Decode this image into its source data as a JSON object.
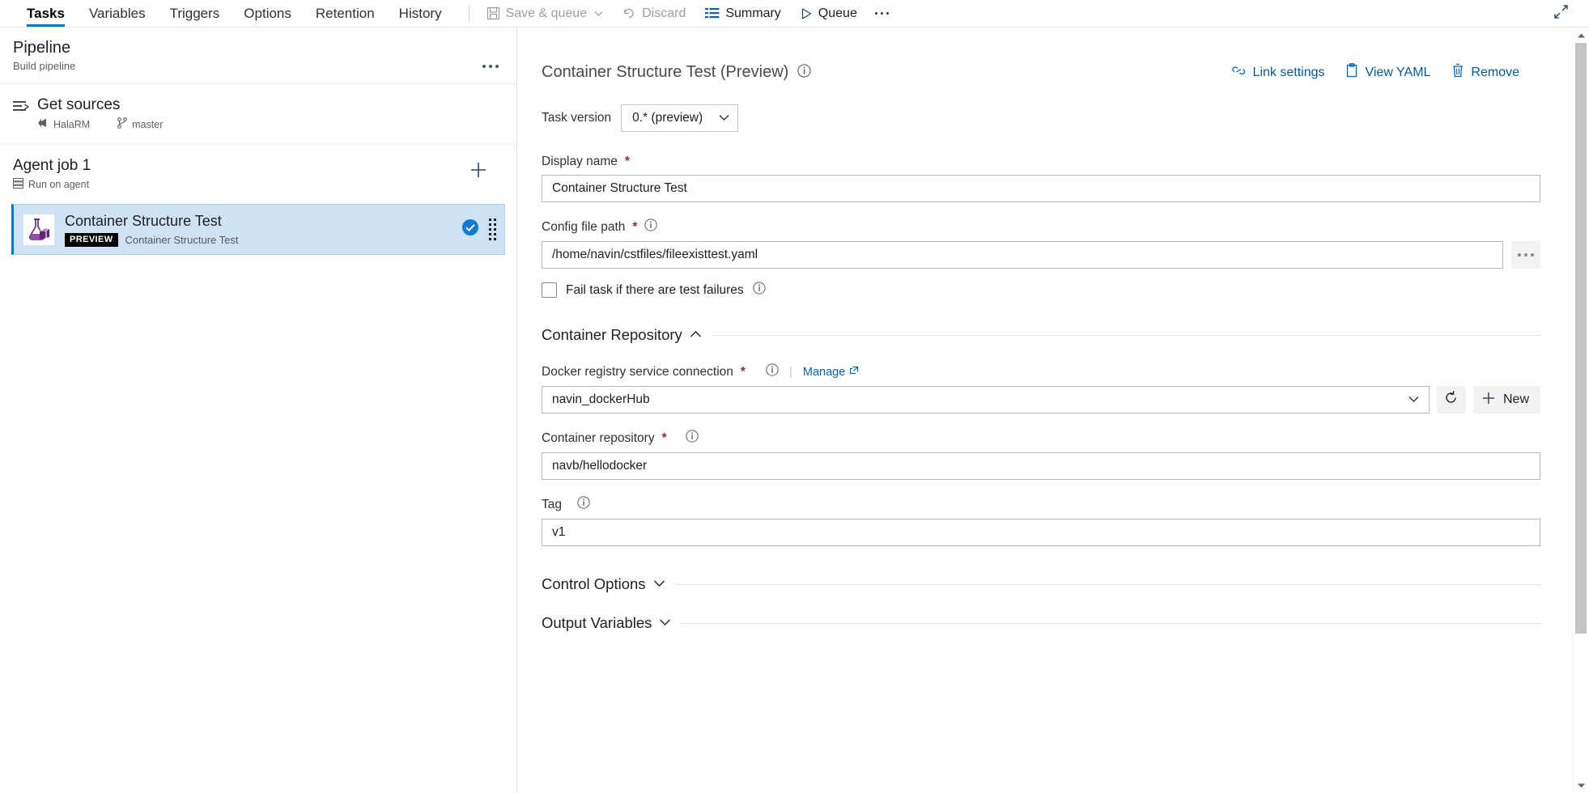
{
  "topbar": {
    "tabs": [
      {
        "label": "Tasks",
        "active": true
      },
      {
        "label": "Variables",
        "active": false
      },
      {
        "label": "Triggers",
        "active": false
      },
      {
        "label": "Options",
        "active": false
      },
      {
        "label": "Retention",
        "active": false
      },
      {
        "label": "History",
        "active": false
      }
    ],
    "commands": {
      "save_and_queue": "Save & queue",
      "discard": "Discard",
      "summary": "Summary",
      "queue": "Queue"
    }
  },
  "sidebar": {
    "pipeline": {
      "title": "Pipeline",
      "subtitle": "Build pipeline"
    },
    "get_sources": {
      "title": "Get sources",
      "repo": "HalaRM",
      "branch": "master"
    },
    "agent_job": {
      "title": "Agent job 1",
      "subtitle": "Run on agent"
    },
    "task": {
      "name": "Container Structure Test",
      "badge": "PREVIEW",
      "subtitle": "Container Structure Test"
    }
  },
  "detail": {
    "title": "Container Structure Test (Preview)",
    "links": {
      "link_settings": "Link settings",
      "view_yaml": "View YAML",
      "remove": "Remove"
    },
    "task_version": {
      "label": "Task version",
      "value": "0.* (preview)",
      "options": [
        "0.* (preview)"
      ]
    },
    "display_name": {
      "label": "Display name",
      "required": true,
      "value": "Container Structure Test"
    },
    "config_file_path": {
      "label": "Config file path",
      "required": true,
      "value": "/home/navin/cstfiles/fileexisttest.yaml"
    },
    "fail_task": {
      "label": "Fail task if there are test failures",
      "checked": false
    },
    "container_repository_section": {
      "title": "Container Repository",
      "expanded": true
    },
    "docker_registry": {
      "label": "Docker registry service connection",
      "required": true,
      "manage_label": "Manage",
      "value": "navin_dockerHub",
      "new_label": "New"
    },
    "container_repository": {
      "label": "Container repository",
      "required": true,
      "value": "navb/hellodocker"
    },
    "tag": {
      "label": "Tag",
      "required": false,
      "value": "v1"
    },
    "control_options": {
      "title": "Control Options",
      "expanded": false
    },
    "output_variables": {
      "title": "Output Variables",
      "expanded": false
    }
  },
  "colors": {
    "accent": "#0078d4",
    "link": "#005a9e",
    "required": "#a4262c",
    "selection_bg": "#cfe2f6",
    "disabled_text": "#a19f9d"
  }
}
